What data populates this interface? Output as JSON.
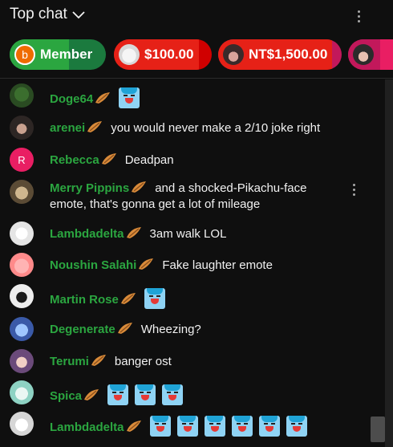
{
  "header": {
    "title": "Top chat"
  },
  "tickers": [
    {
      "label": "Member",
      "avatar_letter": "b"
    },
    {
      "label": "$100.00"
    },
    {
      "label": "NT$1,500.00"
    },
    {
      "label": ""
    }
  ],
  "messages": [
    {
      "author": "Doge64",
      "text": "",
      "emotes": 1
    },
    {
      "author": "arenei",
      "text": "you would never make a 2/10 joke right",
      "emotes": 0
    },
    {
      "author": "Rebecca",
      "avatar_letter": "R",
      "text": "Deadpan",
      "emotes": 0
    },
    {
      "author": "Merry Pippins",
      "text": "and a shocked-Pikachu-face",
      "text2": "emote, that's gonna get a lot of mileage",
      "emotes": 0
    },
    {
      "author": "Lambdadelta",
      "text": "3am walk LOL",
      "emotes": 0
    },
    {
      "author": "Noushin Salahi",
      "text": "Fake laughter emote",
      "emotes": 0
    },
    {
      "author": "Martin Rose",
      "text": "",
      "emotes": 1
    },
    {
      "author": "Degenerate",
      "text": "Wheezing?",
      "emotes": 0
    },
    {
      "author": "Terumi",
      "text": "banger ost",
      "emotes": 0
    },
    {
      "author": "Spica",
      "text": "",
      "emotes": 3
    },
    {
      "author": "Lambdadelta",
      "text": "",
      "emotes": 6
    }
  ],
  "colors": {
    "background": "#0f0f0f",
    "author_member": "#2ba640",
    "text": "#f1f1f1",
    "member_ticker": "#2ba640",
    "superchat_red": "#e62117"
  },
  "icons": {
    "chevron": "chevron-down-icon",
    "menu": "more-vert-icon",
    "badge": "member-badge-icon",
    "emote": "laughing-emote-icon"
  }
}
